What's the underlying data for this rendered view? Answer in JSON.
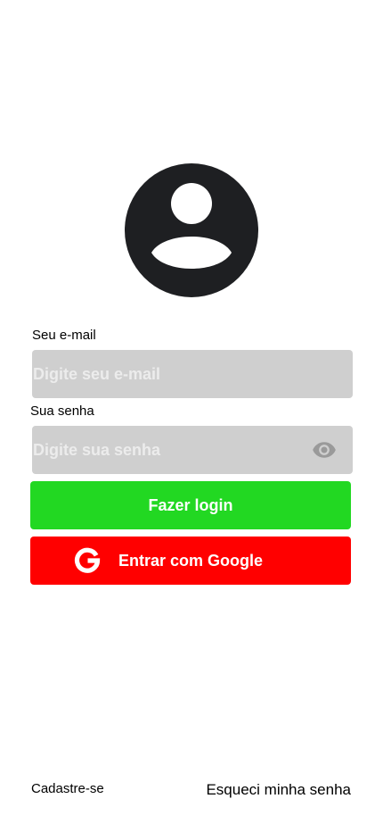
{
  "avatar": {
    "icon": "account-circle-icon",
    "color": "#1e1f22"
  },
  "email": {
    "label": "Seu e-mail",
    "placeholder": "Digite seu e-mail",
    "value": ""
  },
  "password": {
    "label": "Sua senha",
    "placeholder": "Digite sua senha",
    "value": "",
    "toggle_icon": "eye-icon"
  },
  "login_button": {
    "label": "Fazer login",
    "color": "#22d822"
  },
  "google_button": {
    "label": "Entrar com Google",
    "icon": "google-icon",
    "color": "#ff0000"
  },
  "footer": {
    "signup_label": "Cadastre-se",
    "forgot_label": "Esqueci minha senha"
  }
}
